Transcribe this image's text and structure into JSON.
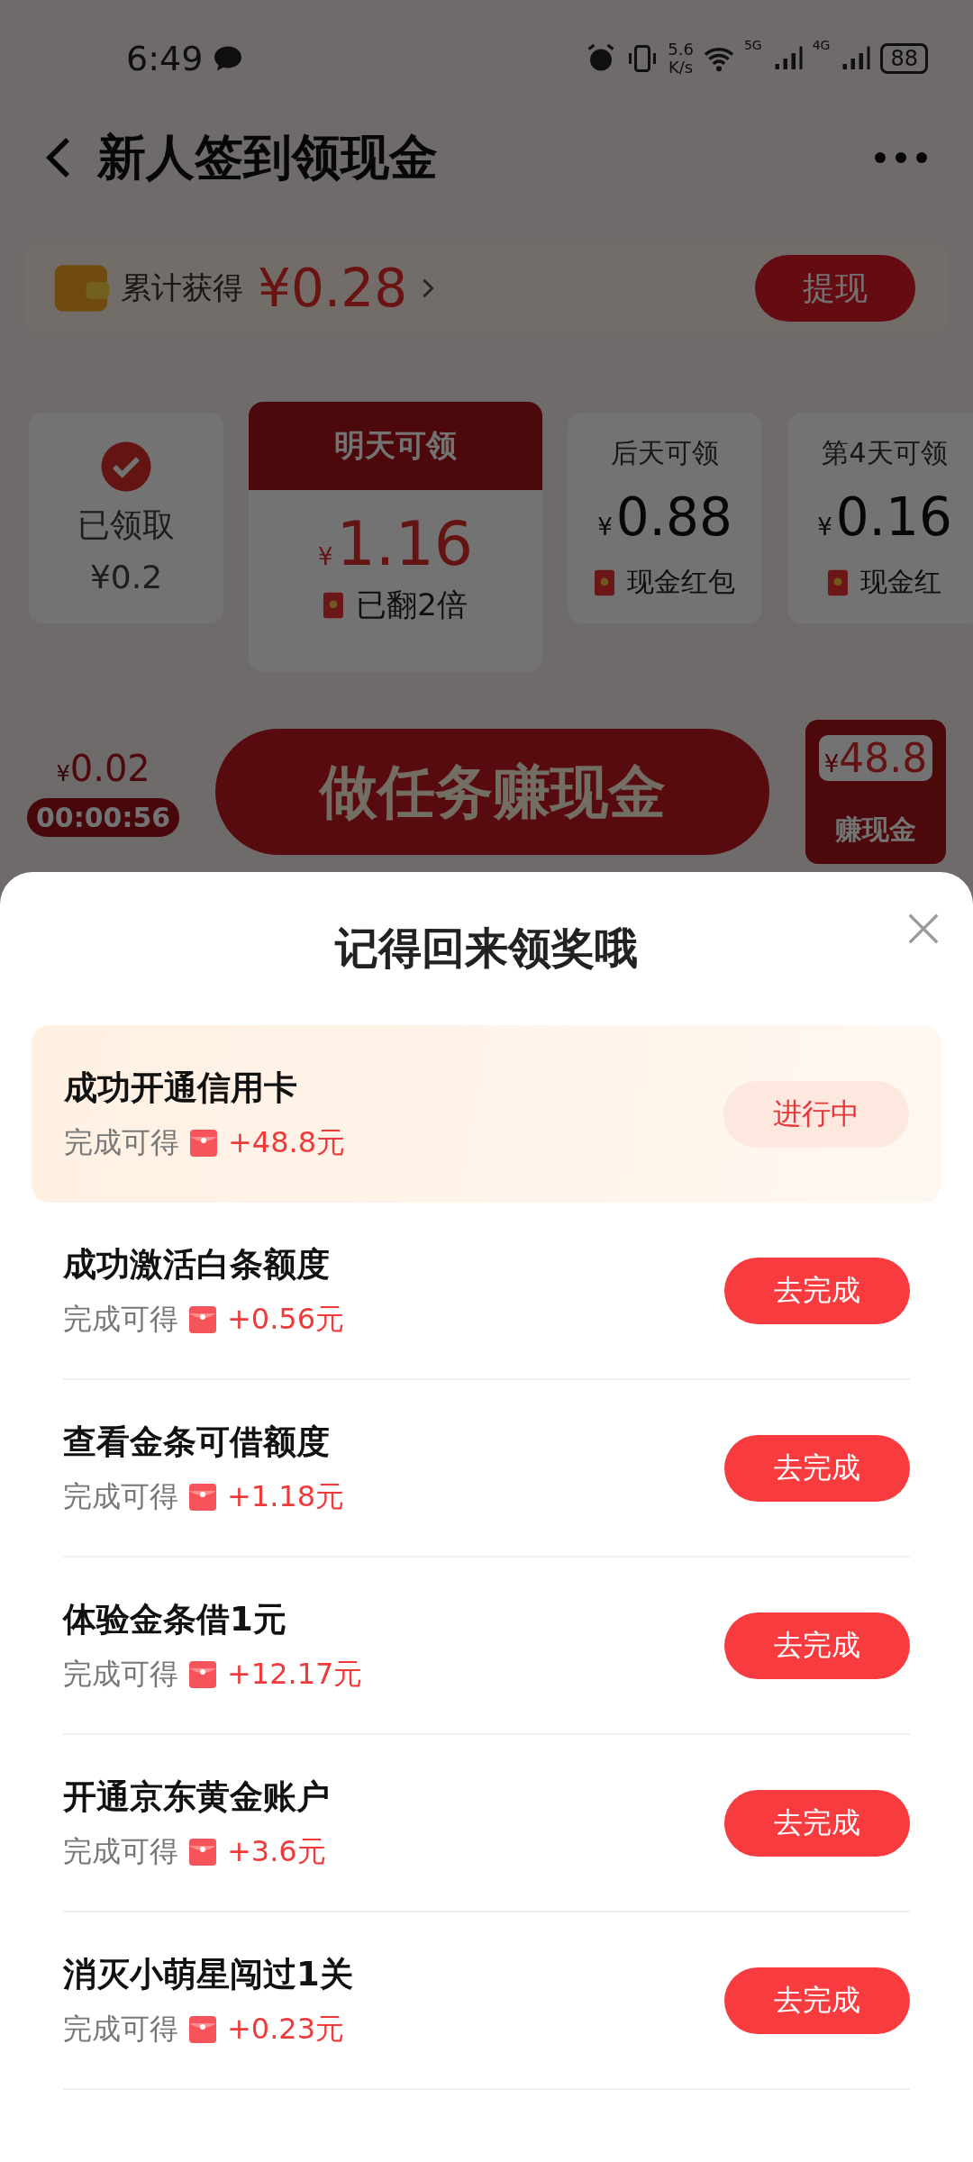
{
  "status_bar": {
    "time": "6:49",
    "speed_value": "5.6",
    "speed_unit": "K/s",
    "network_1": "5G",
    "network_2": "4G",
    "battery": "88"
  },
  "header": {
    "title": "新人签到领现金"
  },
  "summary": {
    "label": "累计获得",
    "amount": "¥0.28",
    "withdraw": "提现"
  },
  "days": [
    {
      "kind": "claimed",
      "label": "已领取",
      "amount": "¥0.2"
    },
    {
      "kind": "tomorrow",
      "label": "明天可领",
      "currency": "¥",
      "amount": "1.16",
      "note": "已翻2倍"
    },
    {
      "kind": "future",
      "label": "后天可领",
      "currency": "¥",
      "amount": "0.88",
      "note": "现金红包"
    },
    {
      "kind": "future",
      "label": "第4天可领",
      "currency": "¥",
      "amount": "0.16",
      "note": "现金红"
    }
  ],
  "bonus": {
    "currency": "¥",
    "amount": "0.02",
    "timer": "00:00:56"
  },
  "task_button": {
    "label": "做任务赚现金"
  },
  "reward_badge": {
    "currency": "¥",
    "amount": "48.8",
    "label": "赚现金"
  },
  "sheet": {
    "title": "记得回来领奖哦",
    "tasks": [
      {
        "title": "成功开通信用卡",
        "reward_label": "完成可得",
        "reward": "+48.8元",
        "action": "进行中",
        "kind": "in_progress"
      },
      {
        "title": "成功激活白条额度",
        "reward_label": "完成可得",
        "reward": "+0.56元",
        "action": "去完成",
        "kind": "todo"
      },
      {
        "title": "查看金条可借额度",
        "reward_label": "完成可得",
        "reward": "+1.18元",
        "action": "去完成",
        "kind": "todo"
      },
      {
        "title": "体验金条借1元",
        "reward_label": "完成可得",
        "reward": "+12.17元",
        "action": "去完成",
        "kind": "todo"
      },
      {
        "title": "开通京东黄金账户",
        "reward_label": "完成可得",
        "reward": "+3.6元",
        "action": "去完成",
        "kind": "todo"
      },
      {
        "title": "消灭小萌星闯过1关",
        "reward_label": "完成可得",
        "reward": "+0.23元",
        "action": "去完成",
        "kind": "todo"
      }
    ]
  }
}
